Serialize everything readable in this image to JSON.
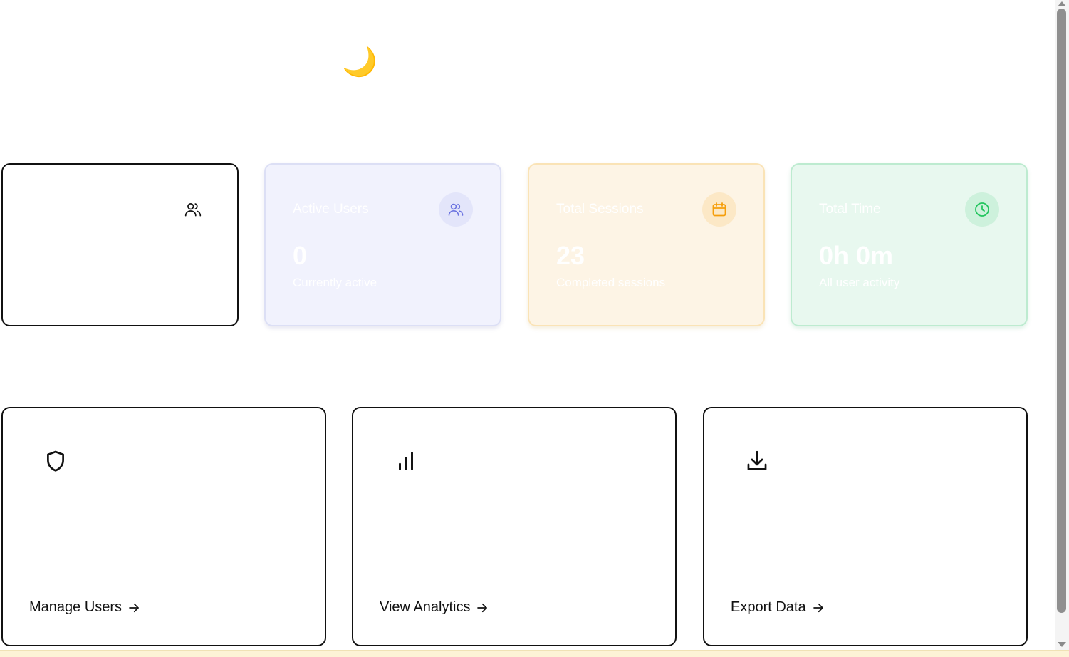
{
  "theme_toggle": {
    "icon": "moon-icon",
    "glyph": "🌙"
  },
  "stats": [
    {
      "title": "",
      "value": "",
      "subtitle": "",
      "icon": "users-icon",
      "color": "#111111"
    },
    {
      "title": "Active Users",
      "value": "0",
      "subtitle": "Currently active",
      "icon": "users-icon",
      "color": "#6b73e0",
      "icon_bg": "#e3e5fa"
    },
    {
      "title": "Total Sessions",
      "value": "23",
      "subtitle": "Completed sessions",
      "icon": "calendar-icon",
      "color": "#f59e0b",
      "icon_bg": "#fce8c6"
    },
    {
      "title": "Total Time",
      "value": "0h 0m",
      "subtitle": "All user activity",
      "icon": "clock-icon",
      "color": "#22c55e",
      "icon_bg": "#cdf1dc"
    }
  ],
  "actions": [
    {
      "label": "Manage Users",
      "icon": "shield-icon"
    },
    {
      "label": "View Analytics",
      "icon": "bar-chart-icon"
    },
    {
      "label": "Export Data",
      "icon": "download-icon"
    }
  ]
}
